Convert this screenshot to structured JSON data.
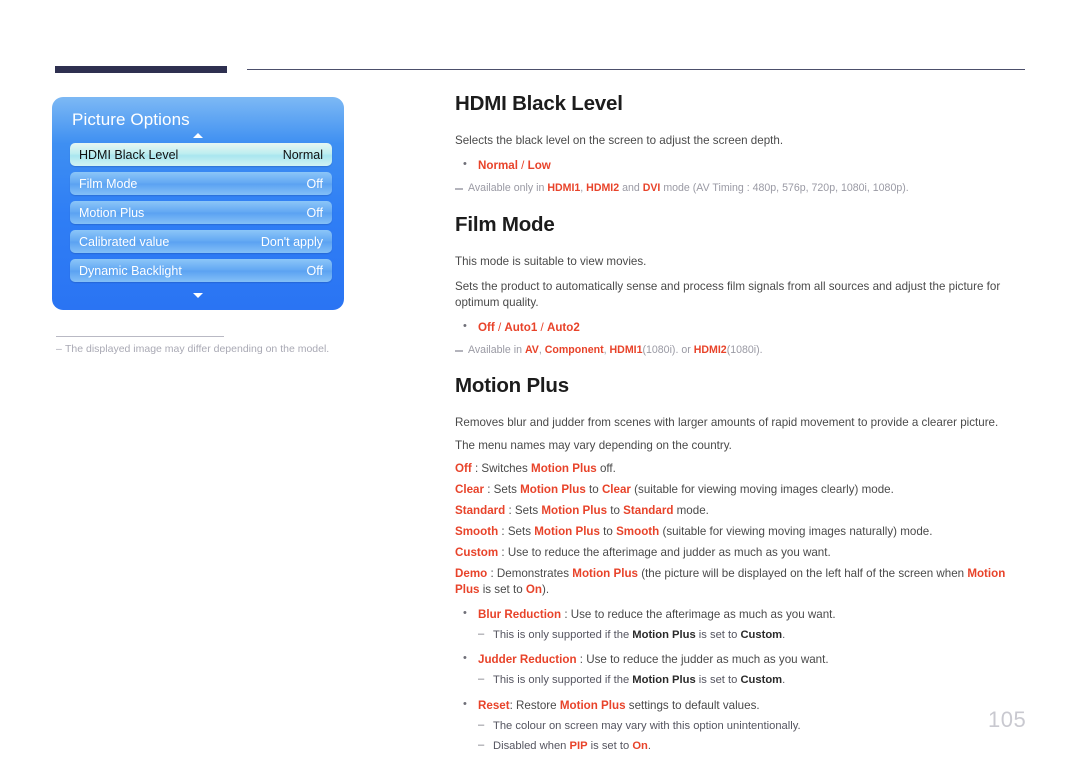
{
  "page": {
    "number": "105"
  },
  "osd": {
    "title": "Picture Options",
    "up_arrow_icon": "triangle-up-icon",
    "down_arrow_icon": "triangle-down-icon",
    "rows": [
      {
        "label": "HDMI Black Level",
        "value": "Normal",
        "selected": true
      },
      {
        "label": "Film Mode",
        "value": "Off",
        "selected": false
      },
      {
        "label": "Motion Plus",
        "value": "Off",
        "selected": false
      },
      {
        "label": "Calibrated value",
        "value": "Don't apply",
        "selected": false
      },
      {
        "label": "Dynamic Backlight",
        "value": "Off",
        "selected": false
      }
    ],
    "note_dash": "–",
    "note": "The displayed image may differ depending on the model."
  },
  "colors": {
    "accent_red": "#e8432a",
    "header_bar": "#2e3050",
    "osd_blue": "#2f7ef5",
    "osd_selected": "#bfeef0",
    "page_number_grey": "#c9c9d0"
  },
  "sections": {
    "hdmi_black_level": {
      "title": "HDMI Black Level",
      "desc": "Selects the black level on the screen to adjust the screen depth.",
      "options_bullet": {
        "first": "Normal",
        "sep": " / ",
        "second": "Low"
      },
      "note_prefix": "Available only in ",
      "note_v1": "HDMI1",
      "note_c1": ", ",
      "note_v2": "HDMI2",
      "note_mid": " and ",
      "note_v3": "DVI",
      "note_suffix": " mode (AV Timing : 480p, 576p, 720p, 1080i, 1080p)."
    },
    "film_mode": {
      "title": "Film Mode",
      "desc1": "This mode is suitable to view movies.",
      "desc2": "Sets the product to automatically sense and process film signals from all sources and adjust the picture for optimum quality.",
      "options_bullet": {
        "o1": "Off",
        "sep1": " / ",
        "o2": "Auto1",
        "sep2": " / ",
        "o3": "Auto2"
      },
      "note_prefix": "Available in ",
      "note_v1": "AV",
      "note_c1": ", ",
      "note_v2": "Component",
      "note_c2": ", ",
      "note_v3": "HDMI1",
      "note_q1": "(1080i). or ",
      "note_v4": "HDMI2",
      "note_q2": "(1080i)."
    },
    "motion_plus": {
      "title": "Motion Plus",
      "desc1": "Removes blur and judder from scenes with larger amounts of rapid movement to provide a clearer picture.",
      "desc2": "The menu names may vary depending on the country.",
      "lines": [
        {
          "key": "Off",
          "sep": " : Switches ",
          "mid_bold": "Motion Plus",
          "tail": " off."
        },
        {
          "key": "Clear",
          "sep": " : Sets ",
          "mid_bold": "Motion Plus",
          "to": " to ",
          "target": "Clear",
          "tail": " (suitable for viewing moving images clearly) mode."
        },
        {
          "key": "Standard",
          "sep": " : Sets ",
          "mid_bold": "Motion Plus",
          "to": " to ",
          "target": "Standard",
          "tail": " mode."
        },
        {
          "key": "Smooth",
          "sep": " : Sets ",
          "mid_bold": "Motion Plus",
          "to": " to ",
          "target": "Smooth",
          "tail": " (suitable for viewing moving images naturally) mode."
        },
        {
          "key": "Custom",
          "sep": " : Use to reduce the afterimage and judder as much as you want.",
          "mid_bold": "",
          "tail": ""
        }
      ],
      "demo": {
        "key": "Demo",
        "sep": " : Demonstrates ",
        "mid_bold": "Motion Plus",
        "mid_text": " (the picture will be displayed on the left half of the screen when ",
        "bold2": "Motion Plus",
        "mid_text2": " is set to ",
        "on": "On",
        "tail": ")."
      },
      "blur_reduction": {
        "key": "Blur Reduction",
        "text": " : Use to reduce the afterimage as much as you want.",
        "sub_pre": "This is only supported if the ",
        "sub_b1": "Motion Plus",
        "sub_mid": " is set to ",
        "sub_b2": "Custom",
        "sub_tail": "."
      },
      "judder_reduction": {
        "key": "Judder Reduction",
        "text": " : Use to reduce the judder as much as you want.",
        "sub_pre": "This is only supported if the ",
        "sub_b1": "Motion Plus",
        "sub_mid": " is set to ",
        "sub_b2": "Custom",
        "sub_tail": "."
      },
      "reset": {
        "key": "Reset",
        "pre": ": Restore ",
        "bold": "Motion Plus",
        "tail": " settings to default values.",
        "sub1": "The colour on screen may vary with this option unintentionally.",
        "sub2_pre": "Disabled when ",
        "sub2_b1": "PIP",
        "sub2_mid": " is set to ",
        "sub2_b2": "On",
        "sub2_tail": "."
      }
    }
  }
}
